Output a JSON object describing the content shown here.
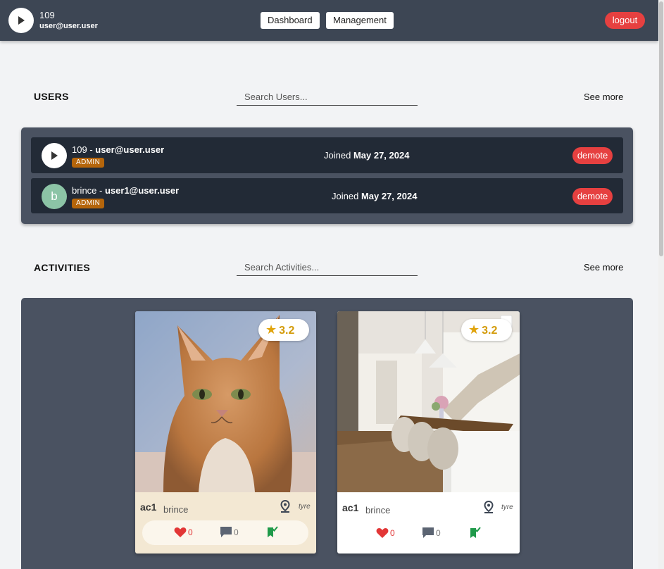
{
  "header": {
    "user_id": "109",
    "user_email": "user@user.user",
    "nav": [
      "Dashboard",
      "Management"
    ],
    "logout_label": "logout"
  },
  "users_section": {
    "title": "USERS",
    "search_placeholder": "Search Users...",
    "see_more": "See more",
    "rows": [
      {
        "avatar": "play-image",
        "name": "109",
        "email": "user@user.user",
        "role": "ADMIN",
        "joined_prefix": "Joined",
        "joined_date": "May 27, 2024",
        "action": "demote"
      },
      {
        "avatar": "b",
        "name": "brince",
        "email": "user1@user.user",
        "role": "ADMIN",
        "joined_prefix": "Joined",
        "joined_date": "May 27, 2024",
        "action": "demote"
      }
    ]
  },
  "activities_section": {
    "title": "ACTIVITIES",
    "search_placeholder": "Search Activities...",
    "see_more": "See more",
    "cards": [
      {
        "image": "cat-photo",
        "rating": "3.2",
        "title": "ac1",
        "author": "brince",
        "location": "tyre",
        "likes": "0",
        "comments": "0"
      },
      {
        "image": "dining-room-photo",
        "rating": "3.2",
        "title": "ac1",
        "author": "brince",
        "location": "tyre",
        "likes": "0",
        "comments": "0"
      }
    ]
  },
  "colors": {
    "header_bg": "#3d4654",
    "panel_bg": "#4a5261",
    "row_bg": "#222a36",
    "danger": "#e64040",
    "badge": "#b5650b",
    "star": "#e0a30b",
    "like": "#e23636",
    "bookmark": "#1f9a4a"
  },
  "icons": [
    "play-icon",
    "star-icon",
    "map-pin-icon",
    "heart-icon",
    "comment-icon",
    "bookmark-check-icon"
  ]
}
